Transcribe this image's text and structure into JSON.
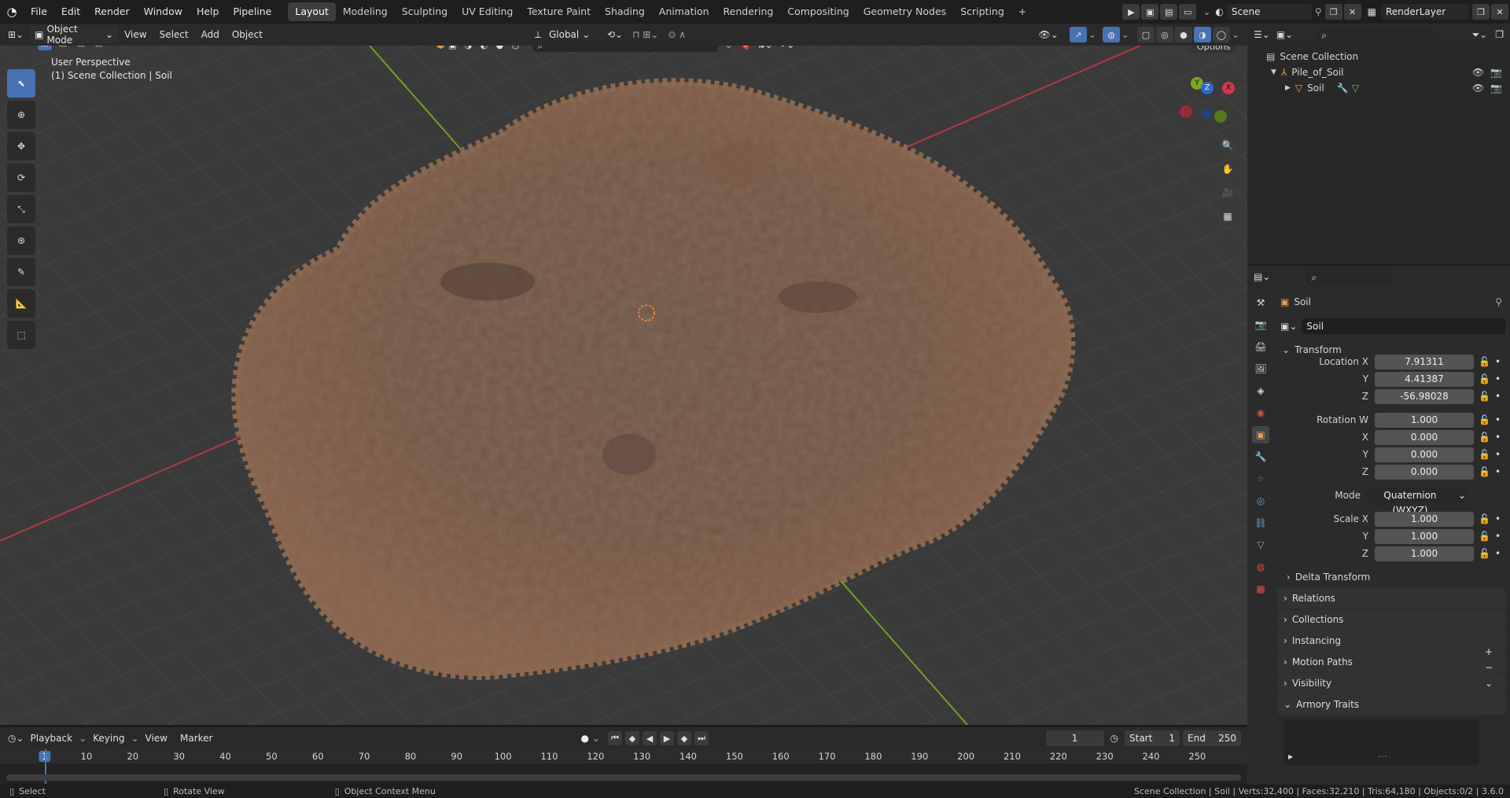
{
  "topbar": {
    "menus": [
      "File",
      "Edit",
      "Render",
      "Window",
      "Help",
      "Pipeline"
    ],
    "workspaces": [
      "Layout",
      "Modeling",
      "Sculpting",
      "UV Editing",
      "Texture Paint",
      "Shading",
      "Animation",
      "Rendering",
      "Compositing",
      "Geometry Nodes",
      "Scripting"
    ],
    "active_workspace": "Layout",
    "add_tab": "+",
    "scene": "Scene",
    "render_layer": "RenderLayer"
  },
  "viewport_header": {
    "mode": "Object Mode",
    "menus": [
      "View",
      "Select",
      "Add",
      "Object"
    ],
    "orientation": "Global",
    "options": "Options"
  },
  "viewport": {
    "view_name": "User Perspective",
    "context": "(1) Scene Collection | Soil",
    "gizmo": {
      "x": "X",
      "y": "Y",
      "z": "Z"
    }
  },
  "outliner": {
    "root": "Scene Collection",
    "collection": "Pile_of_Soil",
    "object": "Soil"
  },
  "properties": {
    "object_name": "Soil",
    "data_name": "Soil",
    "transform_title": "Transform",
    "location": {
      "label_x": "Location X",
      "label_y": "Y",
      "label_z": "Z",
      "x": "7.91311",
      "y": "4.41387",
      "z": "-56.98028"
    },
    "rotation": {
      "label_w": "Rotation W",
      "label_x": "X",
      "label_y": "Y",
      "label_z": "Z",
      "w": "1.000",
      "x": "0.000",
      "y": "0.000",
      "z": "0.000"
    },
    "mode_label": "Mode",
    "mode": "Quaternion (WXYZ)",
    "scale": {
      "label_x": "Scale X",
      "label_y": "Y",
      "label_z": "Z",
      "x": "1.000",
      "y": "1.000",
      "z": "1.000"
    },
    "delta": "Delta Transform",
    "sections": [
      "Relations",
      "Collections",
      "Instancing",
      "Motion Paths",
      "Visibility",
      "Armory Traits"
    ]
  },
  "timeline": {
    "menus": [
      "Playback",
      "Keying",
      "View",
      "Marker"
    ],
    "current_frame": "1",
    "start_label": "Start",
    "start": "1",
    "end_label": "End",
    "end": "250",
    "ticks": [
      "1",
      "10",
      "20",
      "30",
      "40",
      "50",
      "60",
      "70",
      "80",
      "90",
      "100",
      "110",
      "120",
      "130",
      "140",
      "150",
      "160",
      "170",
      "180",
      "190",
      "200",
      "210",
      "220",
      "230",
      "240",
      "250"
    ]
  },
  "statusbar": {
    "select": "Select",
    "rotate": "Rotate View",
    "context_menu": "Object Context Menu",
    "info": "Scene Collection | Soil | Verts:32,400 | Faces:32,210 | Tris:64,180 | Objects:0/2 | 3.6.0"
  },
  "colors": {
    "accent": "#4772b3",
    "axis_x": "#c0394a",
    "axis_y": "#7ca822",
    "soil": "#7a5a44"
  }
}
